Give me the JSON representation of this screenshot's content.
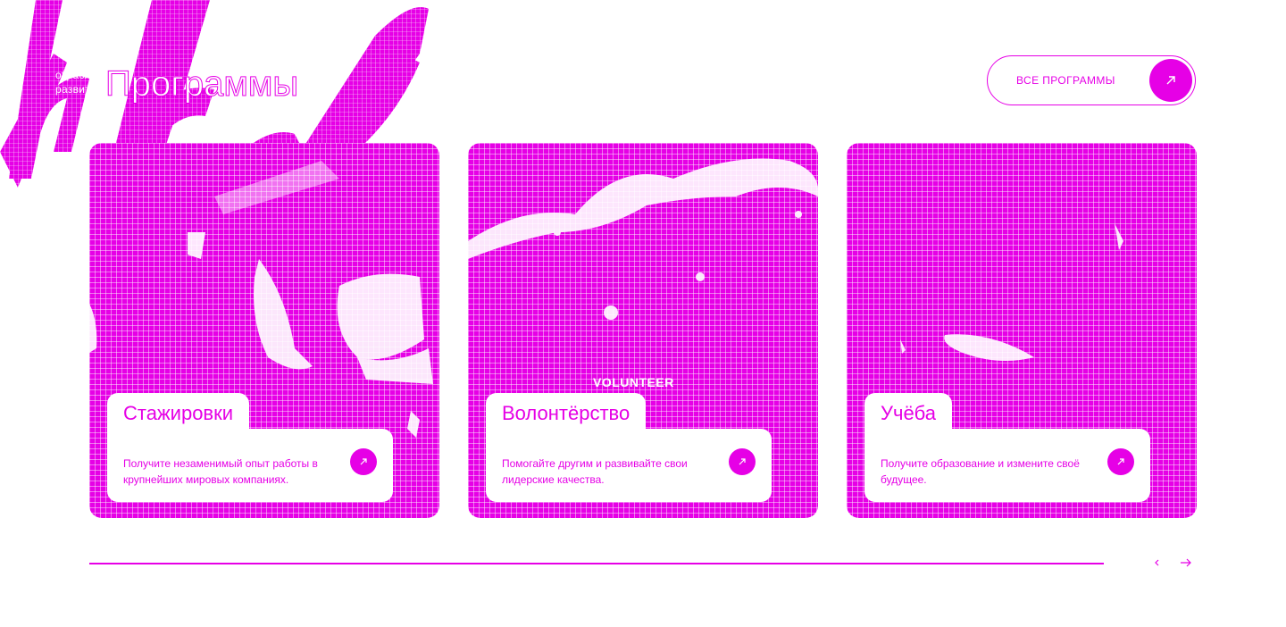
{
  "header": {
    "eyebrow_line1": "отрасль",
    "eyebrow_line2": "развитие",
    "title": "Программы",
    "all_programs_label": "ВСЕ ПРОГРАММЫ",
    "all_programs_icon": "arrow-right-icon"
  },
  "cards": [
    {
      "title": "Стажировки",
      "description": "Получите незаменимый опыт работы в крупнейших мировых компаниях.",
      "icon": "arrow-right-icon"
    },
    {
      "title": "Волонтёрство",
      "description": "Помогайте другим и развивайте свои лидерские качества.",
      "overlay_text": "VOLUNTEER",
      "icon": "arrow-right-icon"
    },
    {
      "title": "Учёба",
      "description": "Получите образование и измените своё будущее.",
      "icon": "arrow-right-icon"
    }
  ],
  "slider": {
    "progress": 1.0,
    "prev_icon": "chevron-left-icon",
    "next_icon": "arrow-right-icon"
  },
  "colors": {
    "accent": "#e600e6",
    "background": "#ffffff"
  }
}
